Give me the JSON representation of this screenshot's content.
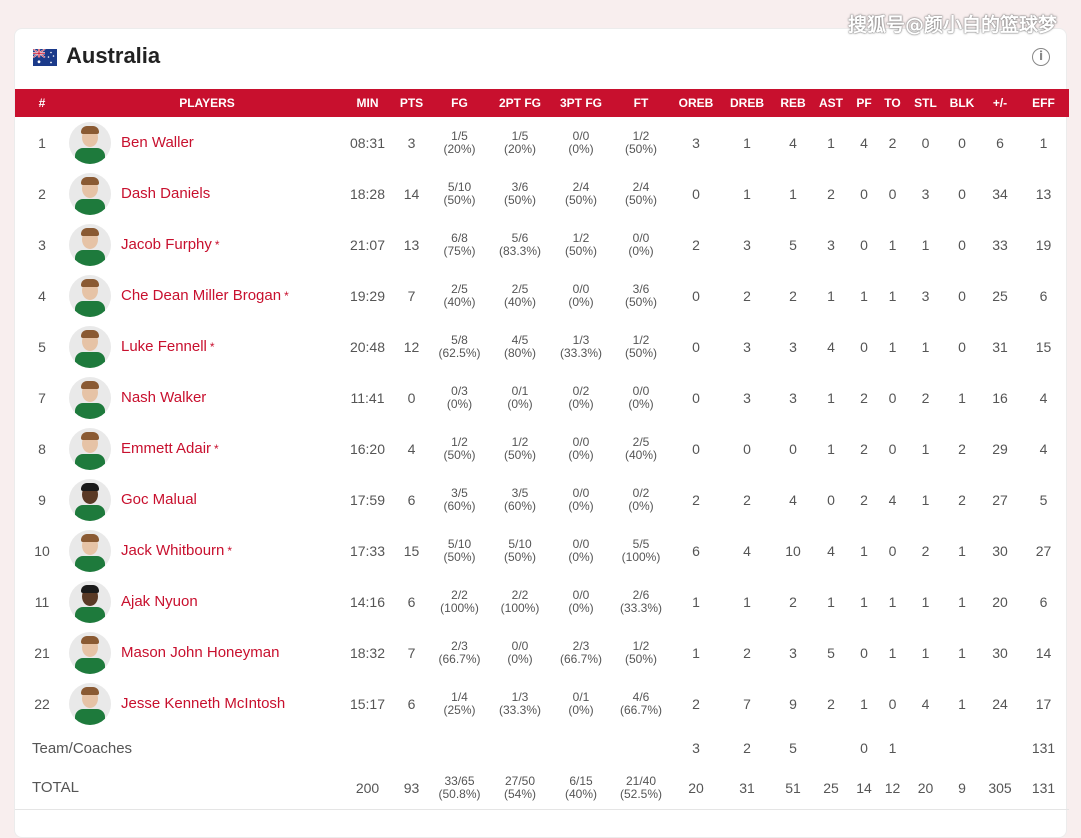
{
  "watermark": "搜狐号@颜小白的篮球梦",
  "team": {
    "name": "Australia",
    "flag_icon": "australia-flag-icon",
    "info_icon": "info-icon"
  },
  "columns": [
    "#",
    "PLAYERS",
    "MIN",
    "PTS",
    "FG",
    "2PT FG",
    "3PT FG",
    "FT",
    "OREB",
    "DREB",
    "REB",
    "AST",
    "PF",
    "TO",
    "STL",
    "BLK",
    "+/-",
    "EFF"
  ],
  "players": [
    {
      "no": "1",
      "name": "Ben Waller",
      "starter": false,
      "dark": false,
      "min": "08:31",
      "pts": "3",
      "fg": "1/5",
      "fg_pct": "(20%)",
      "fg2": "1/5",
      "fg2_pct": "(20%)",
      "fg3": "0/0",
      "fg3_pct": "(0%)",
      "ft": "1/2",
      "ft_pct": "(50%)",
      "oreb": "3",
      "dreb": "1",
      "reb": "4",
      "ast": "1",
      "pf": "4",
      "to": "2",
      "stl": "0",
      "blk": "0",
      "pm": "6",
      "eff": "1"
    },
    {
      "no": "2",
      "name": "Dash Daniels",
      "starter": false,
      "dark": false,
      "min": "18:28",
      "pts": "14",
      "fg": "5/10",
      "fg_pct": "(50%)",
      "fg2": "3/6",
      "fg2_pct": "(50%)",
      "fg3": "2/4",
      "fg3_pct": "(50%)",
      "ft": "2/4",
      "ft_pct": "(50%)",
      "oreb": "0",
      "dreb": "1",
      "reb": "1",
      "ast": "2",
      "pf": "0",
      "to": "0",
      "stl": "3",
      "blk": "0",
      "pm": "34",
      "eff": "13"
    },
    {
      "no": "3",
      "name": "Jacob Furphy",
      "starter": true,
      "dark": false,
      "min": "21:07",
      "pts": "13",
      "fg": "6/8",
      "fg_pct": "(75%)",
      "fg2": "5/6",
      "fg2_pct": "(83.3%)",
      "fg3": "1/2",
      "fg3_pct": "(50%)",
      "ft": "0/0",
      "ft_pct": "(0%)",
      "oreb": "2",
      "dreb": "3",
      "reb": "5",
      "ast": "3",
      "pf": "0",
      "to": "1",
      "stl": "1",
      "blk": "0",
      "pm": "33",
      "eff": "19"
    },
    {
      "no": "4",
      "name": "Che Dean Miller Brogan",
      "starter": true,
      "dark": false,
      "min": "19:29",
      "pts": "7",
      "fg": "2/5",
      "fg_pct": "(40%)",
      "fg2": "2/5",
      "fg2_pct": "(40%)",
      "fg3": "0/0",
      "fg3_pct": "(0%)",
      "ft": "3/6",
      "ft_pct": "(50%)",
      "oreb": "0",
      "dreb": "2",
      "reb": "2",
      "ast": "1",
      "pf": "1",
      "to": "1",
      "stl": "3",
      "blk": "0",
      "pm": "25",
      "eff": "6"
    },
    {
      "no": "5",
      "name": "Luke Fennell",
      "starter": true,
      "dark": false,
      "min": "20:48",
      "pts": "12",
      "fg": "5/8",
      "fg_pct": "(62.5%)",
      "fg2": "4/5",
      "fg2_pct": "(80%)",
      "fg3": "1/3",
      "fg3_pct": "(33.3%)",
      "ft": "1/2",
      "ft_pct": "(50%)",
      "oreb": "0",
      "dreb": "3",
      "reb": "3",
      "ast": "4",
      "pf": "0",
      "to": "1",
      "stl": "1",
      "blk": "0",
      "pm": "31",
      "eff": "15"
    },
    {
      "no": "7",
      "name": "Nash Walker",
      "starter": false,
      "dark": false,
      "min": "11:41",
      "pts": "0",
      "fg": "0/3",
      "fg_pct": "(0%)",
      "fg2": "0/1",
      "fg2_pct": "(0%)",
      "fg3": "0/2",
      "fg3_pct": "(0%)",
      "ft": "0/0",
      "ft_pct": "(0%)",
      "oreb": "0",
      "dreb": "3",
      "reb": "3",
      "ast": "1",
      "pf": "2",
      "to": "0",
      "stl": "2",
      "blk": "1",
      "pm": "16",
      "eff": "4"
    },
    {
      "no": "8",
      "name": "Emmett Adair",
      "starter": true,
      "dark": false,
      "min": "16:20",
      "pts": "4",
      "fg": "1/2",
      "fg_pct": "(50%)",
      "fg2": "1/2",
      "fg2_pct": "(50%)",
      "fg3": "0/0",
      "fg3_pct": "(0%)",
      "ft": "2/5",
      "ft_pct": "(40%)",
      "oreb": "0",
      "dreb": "0",
      "reb": "0",
      "ast": "1",
      "pf": "2",
      "to": "0",
      "stl": "1",
      "blk": "2",
      "pm": "29",
      "eff": "4"
    },
    {
      "no": "9",
      "name": "Goc Malual",
      "starter": false,
      "dark": true,
      "min": "17:59",
      "pts": "6",
      "fg": "3/5",
      "fg_pct": "(60%)",
      "fg2": "3/5",
      "fg2_pct": "(60%)",
      "fg3": "0/0",
      "fg3_pct": "(0%)",
      "ft": "0/2",
      "ft_pct": "(0%)",
      "oreb": "2",
      "dreb": "2",
      "reb": "4",
      "ast": "0",
      "pf": "2",
      "to": "4",
      "stl": "1",
      "blk": "2",
      "pm": "27",
      "eff": "5"
    },
    {
      "no": "10",
      "name": "Jack Whitbourn",
      "starter": true,
      "dark": false,
      "min": "17:33",
      "pts": "15",
      "fg": "5/10",
      "fg_pct": "(50%)",
      "fg2": "5/10",
      "fg2_pct": "(50%)",
      "fg3": "0/0",
      "fg3_pct": "(0%)",
      "ft": "5/5",
      "ft_pct": "(100%)",
      "oreb": "6",
      "dreb": "4",
      "reb": "10",
      "ast": "4",
      "pf": "1",
      "to": "0",
      "stl": "2",
      "blk": "1",
      "pm": "30",
      "eff": "27"
    },
    {
      "no": "11",
      "name": "Ajak Nyuon",
      "starter": false,
      "dark": true,
      "min": "14:16",
      "pts": "6",
      "fg": "2/2",
      "fg_pct": "(100%)",
      "fg2": "2/2",
      "fg2_pct": "(100%)",
      "fg3": "0/0",
      "fg3_pct": "(0%)",
      "ft": "2/6",
      "ft_pct": "(33.3%)",
      "oreb": "1",
      "dreb": "1",
      "reb": "2",
      "ast": "1",
      "pf": "1",
      "to": "1",
      "stl": "1",
      "blk": "1",
      "pm": "20",
      "eff": "6"
    },
    {
      "no": "21",
      "name": "Mason John Honeyman",
      "starter": false,
      "dark": false,
      "min": "18:32",
      "pts": "7",
      "fg": "2/3",
      "fg_pct": "(66.7%)",
      "fg2": "0/0",
      "fg2_pct": "(0%)",
      "fg3": "2/3",
      "fg3_pct": "(66.7%)",
      "ft": "1/2",
      "ft_pct": "(50%)",
      "oreb": "1",
      "dreb": "2",
      "reb": "3",
      "ast": "5",
      "pf": "0",
      "to": "1",
      "stl": "1",
      "blk": "1",
      "pm": "30",
      "eff": "14"
    },
    {
      "no": "22",
      "name": "Jesse Kenneth McIntosh",
      "starter": false,
      "dark": false,
      "min": "15:17",
      "pts": "6",
      "fg": "1/4",
      "fg_pct": "(25%)",
      "fg2": "1/3",
      "fg2_pct": "(33.3%)",
      "fg3": "0/1",
      "fg3_pct": "(0%)",
      "ft": "4/6",
      "ft_pct": "(66.7%)",
      "oreb": "2",
      "dreb": "7",
      "reb": "9",
      "ast": "2",
      "pf": "1",
      "to": "0",
      "stl": "4",
      "blk": "1",
      "pm": "24",
      "eff": "17"
    }
  ],
  "team_row": {
    "label": "Team/Coaches",
    "oreb": "3",
    "dreb": "2",
    "reb": "5",
    "ast": "",
    "pf": "0",
    "to": "1",
    "stl": "",
    "blk": "",
    "pm": "",
    "eff": "131"
  },
  "total_row": {
    "label": "TOTAL",
    "min": "200",
    "pts": "93",
    "fg": "33/65",
    "fg_pct": "(50.8%)",
    "fg2": "27/50",
    "fg2_pct": "(54%)",
    "fg3": "6/15",
    "fg3_pct": "(40%)",
    "ft": "21/40",
    "ft_pct": "(52.5%)",
    "oreb": "20",
    "dreb": "31",
    "reb": "51",
    "ast": "25",
    "pf": "14",
    "to": "12",
    "stl": "20",
    "blk": "9",
    "pm": "305",
    "eff": "131"
  },
  "star_mark": "*",
  "colors": {
    "header_bg": "#c8102e",
    "player_link": "#c8102e",
    "background": "#f8eeee"
  }
}
